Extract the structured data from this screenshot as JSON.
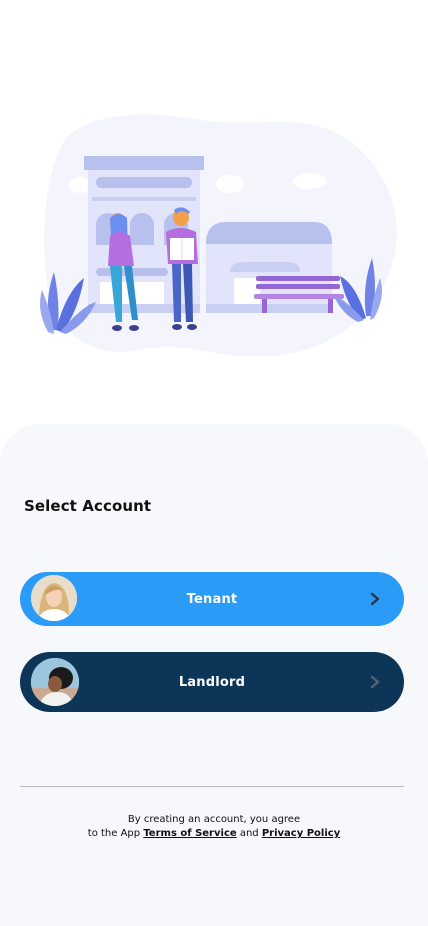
{
  "colors": {
    "tenant_button": "#2a9bf6",
    "landlord_button": "#0c3558",
    "panel_background": "#f7f8fc"
  },
  "hero": {
    "illustration": "city-street-people-illustration"
  },
  "account": {
    "title": "Select Account",
    "tenant_label": "Tenant",
    "landlord_label": "Landlord",
    "tenant_icon": "chevron-right-icon",
    "landlord_icon": "chevron-right-icon"
  },
  "legal": {
    "line1": "By creating an account, you agree",
    "line2_prefix": "to the App ",
    "terms_label": "Terms of Service",
    "conjunction": " and ",
    "privacy_label": "Privacy Policy"
  }
}
